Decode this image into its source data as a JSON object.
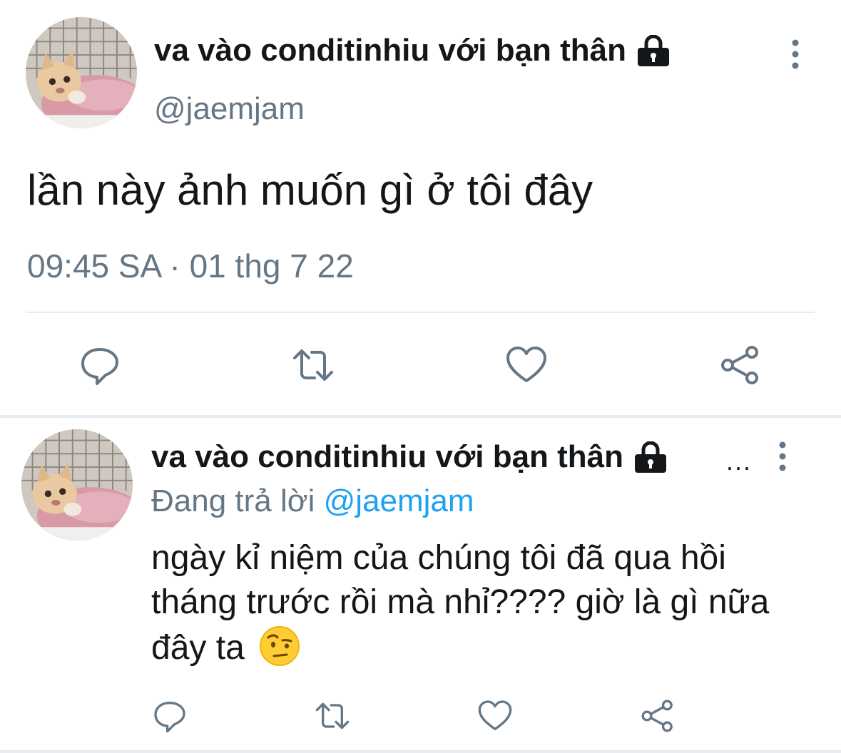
{
  "main_tweet": {
    "display_name": "va vào conditinhiu với bạn thân",
    "handle": "@jaemjam",
    "text": "lần này ảnh muốn gì ở tôi đây",
    "timestamp": "09:45 SA · 01 thg 7 22",
    "actions": [
      "reply-icon",
      "retweet-icon",
      "like-icon",
      "share-icon"
    ]
  },
  "reply_tweet": {
    "display_name": "va vào conditinhiu với bạn thân",
    "truncation": "...",
    "replying_label": "Đang trả lời",
    "replying_to": "@jaemjam",
    "text": "ngày kỉ niệm của chúng tôi đã qua hồi tháng trước rồi mà nhỉ???? giờ là gì nữa đây ta",
    "emoji": "face-with-raised-eyebrow",
    "actions": [
      "reply-icon",
      "retweet-icon",
      "like-icon",
      "share-icon"
    ]
  },
  "colors": {
    "text": "#14171a",
    "muted": "#657786",
    "mention": "#1da1f2",
    "divider": "#e6ecf0"
  }
}
